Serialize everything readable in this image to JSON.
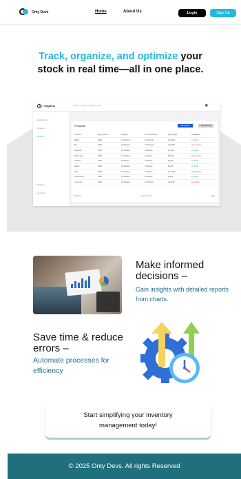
{
  "brand": {
    "name": "Only Devs"
  },
  "nav": {
    "home": "Home",
    "about": "About Us",
    "login": "Login",
    "signup": "Sign Up"
  },
  "hero": {
    "title_accent": "Track, organize, and optimize",
    "title_rest_1": " your",
    "title_rest_2": "stock in real time—all in one place."
  },
  "dashboard": {
    "brand": "OnlyDevs",
    "search_placeholder": "Search product, supplier, order",
    "sidebar": [
      "Dashboard",
      "Inventory",
      "Reports"
    ],
    "sidebar_bottom": [
      "Settings",
      "Log Out"
    ],
    "card_title": "Products",
    "add_button": "Add Product",
    "download_button": "Download all",
    "columns": [
      "Products",
      "Buying Price",
      "Quantity",
      "Threshold Value",
      "Expiry Date",
      "Availability"
    ],
    "rows": [
      [
        "Maggi",
        "₹430",
        "43 Packets",
        "12 Packets",
        "11/12/22",
        "In- stock"
      ],
      [
        "Bru",
        "₹257",
        "22 Packets",
        "12 Packets",
        "21/12/22",
        "Out of stock"
      ],
      [
        "Red Bull",
        "₹405",
        "36 Packets",
        "9 Packets",
        "5/12/22",
        "In- stock"
      ],
      [
        "Bourn Vita",
        "₹502",
        "14 Packets",
        "6 Packets",
        "8/12/22",
        "Out of stock"
      ],
      [
        "Horlicks",
        "₹530",
        "5 Packets",
        "5 Packets",
        "9/1/23",
        "In- stock"
      ],
      [
        "Harpic",
        "₹605",
        "10 Packets",
        "5 Packets",
        "9/1/23",
        "In- stock"
      ],
      [
        "Ariel",
        "₹408",
        "23 Packets",
        "7 Packets",
        "15/12/23",
        "Out of stock"
      ],
      [
        "Scotch Brite",
        "₹359",
        "43 Packets",
        "8 Packets",
        "6/6/23",
        "In- stock"
      ],
      [
        "Coca cola",
        "₹205",
        "41 Packets",
        "10 Packets",
        "11/11/22",
        "Low stock"
      ]
    ],
    "prev": "Previous",
    "page": "Page 1 of 10",
    "next": "Next"
  },
  "feature1": {
    "title": "Make informed decisions –",
    "desc": "Gain insights with detailed reports from charts."
  },
  "feature2": {
    "title": "Save time & reduce errors –",
    "desc": "Automate processes for efficiency"
  },
  "cta": {
    "text": "Start simplifying your inventory management today!"
  },
  "footer": {
    "text": "© 2025 Only Devs. All rights Reserved"
  },
  "colors": {
    "accent": "#25b8de",
    "footer": "#1f6f7c",
    "link_text": "#1f6f8b"
  }
}
